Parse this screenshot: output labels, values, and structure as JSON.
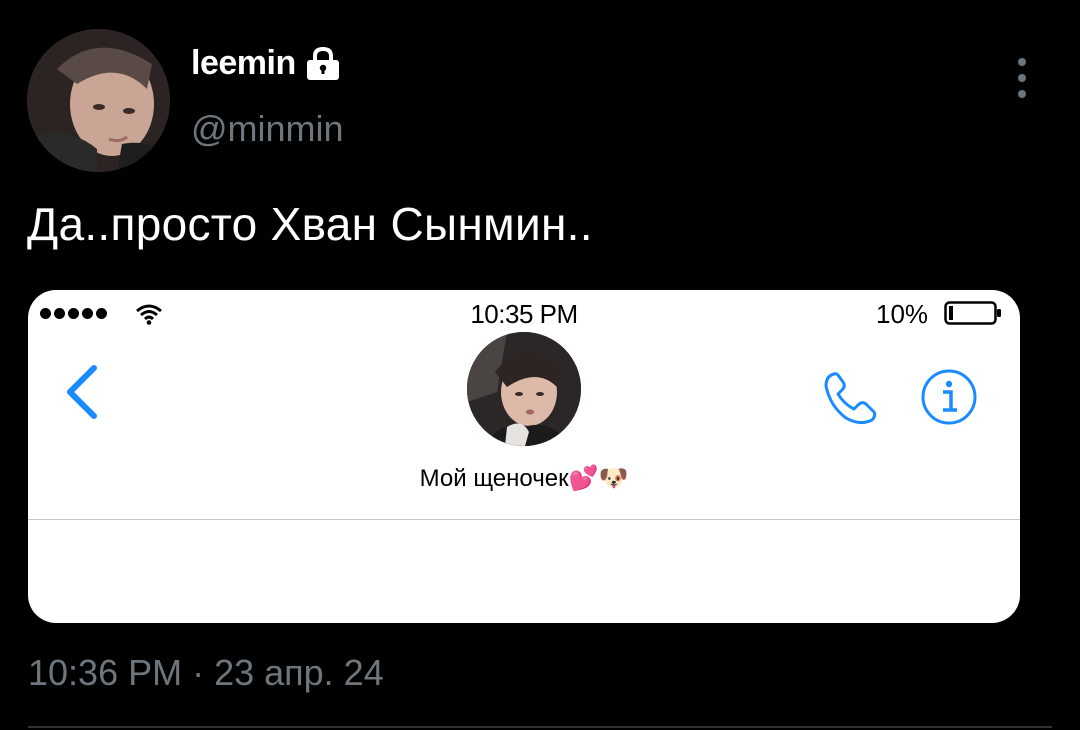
{
  "user": {
    "display_name": "leemin",
    "handle": "@minmin",
    "protected_icon": "lock-icon"
  },
  "tweet": {
    "text": "Да..просто Хван Сынмин..",
    "time": "10:36 PM",
    "separator": "·",
    "date": "23 апр. 24"
  },
  "screenshot": {
    "status_time": "10:35 PM",
    "battery_percent": "10%",
    "contact_name": "Мой щеночек",
    "contact_emoji": "💕🐶",
    "accent_color": "#1a8cff"
  }
}
